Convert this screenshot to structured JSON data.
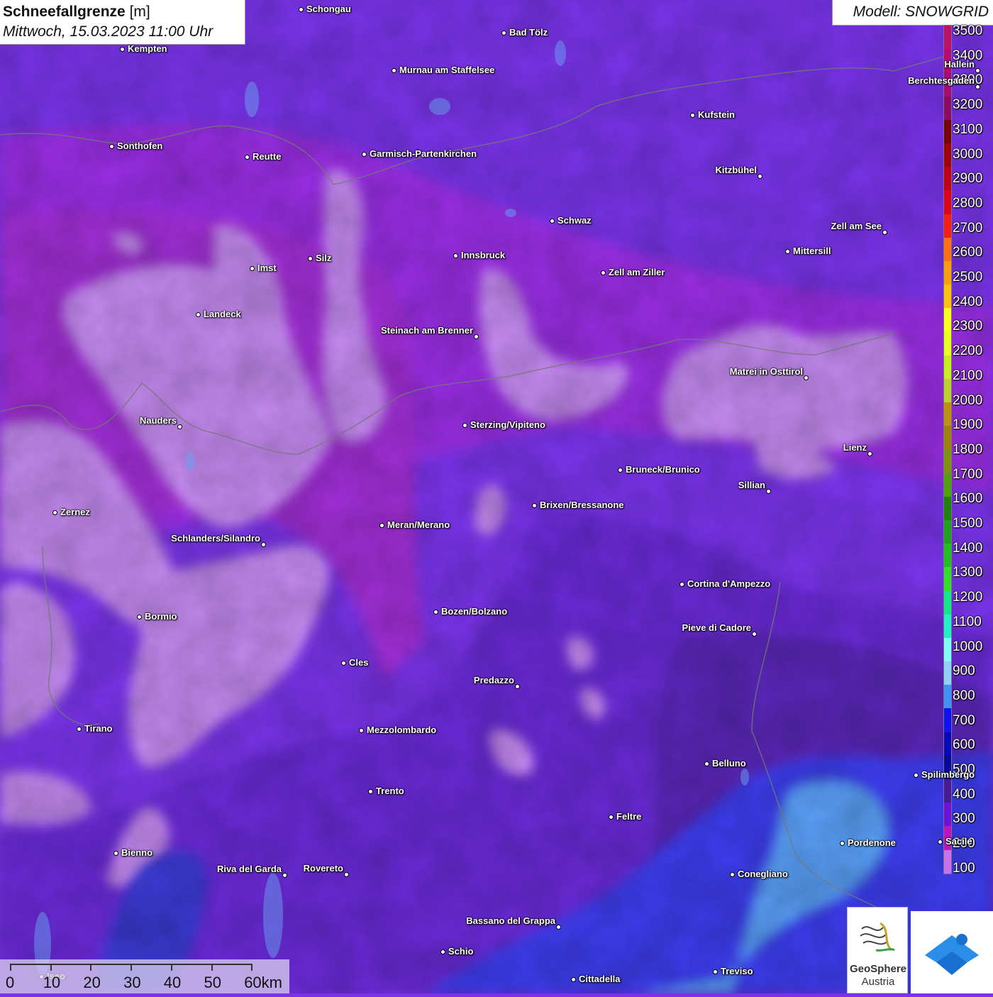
{
  "header": {
    "title_bold": "Schneefallgrenze",
    "title_unit": "[m]",
    "datetime": "Mittwoch, 15.03.2023 11:00 Uhr",
    "model": "Modell: SNOWGRID"
  },
  "legend": {
    "labels": [
      "3500",
      "3400",
      "3300",
      "3200",
      "3100",
      "3000",
      "2900",
      "2800",
      "2700",
      "2600",
      "2500",
      "2400",
      "2300",
      "2200",
      "2100",
      "2000",
      "1900",
      "1800",
      "1700",
      "1600",
      "1500",
      "1400",
      "1300",
      "1200",
      "1100",
      "1000",
      "900",
      "800",
      "700",
      "600",
      "500",
      "400",
      "300",
      "200",
      "100"
    ],
    "colors": [
      "#c0106e",
      "#b8087a",
      "#a8087a",
      "#90086a",
      "#7a0010",
      "#a00010",
      "#c00018",
      "#e00020",
      "#ff1a1a",
      "#ff7010",
      "#ff9c10",
      "#ffc010",
      "#ffff20",
      "#e8ff20",
      "#c8f020",
      "#c0d030",
      "#c09010",
      "#a08010",
      "#809010",
      "#50a010",
      "#208010",
      "#20a020",
      "#20c020",
      "#30e030",
      "#10e890",
      "#20f0d0",
      "#80ffff",
      "#90d0ff",
      "#4090ff",
      "#1010ff",
      "#0808c0",
      "#0808a0",
      "#4818a0",
      "#7010e0",
      "#c010c8",
      "#c870f0"
    ]
  },
  "places": [
    {
      "name": "Schongau"
    },
    {
      "name": "Bad Tölz"
    },
    {
      "name": "Kempten"
    },
    {
      "name": "Murnau am Staffelsee"
    },
    {
      "name": "Hallein"
    },
    {
      "name": "Berchtesgaden"
    },
    {
      "name": "Kufstein"
    },
    {
      "name": "Sonthofen"
    },
    {
      "name": "Reutte"
    },
    {
      "name": "Garmisch-Partenkirchen"
    },
    {
      "name": "Kitzbühel"
    },
    {
      "name": "Schwaz"
    },
    {
      "name": "Zell am See"
    },
    {
      "name": "Mittersill"
    },
    {
      "name": "Innsbruck"
    },
    {
      "name": "Imst"
    },
    {
      "name": "Silz"
    },
    {
      "name": "Zell am Ziller"
    },
    {
      "name": "Landeck"
    },
    {
      "name": "Steinach am Brenner"
    },
    {
      "name": "Matrei in Osttirol"
    },
    {
      "name": "Nauders"
    },
    {
      "name": "Sterzing/Vipiteno"
    },
    {
      "name": "Lienz"
    },
    {
      "name": "Bruneck/Brunico"
    },
    {
      "name": "Sillian"
    },
    {
      "name": "Brixen/Bressanone"
    },
    {
      "name": "Zernez"
    },
    {
      "name": "Meran/Merano"
    },
    {
      "name": "Schlanders/Silandro"
    },
    {
      "name": "Cortina d'Ampezzo"
    },
    {
      "name": "Bozen/Bolzano"
    },
    {
      "name": "Bormio"
    },
    {
      "name": "Pieve di Cadore"
    },
    {
      "name": "Cles"
    },
    {
      "name": "Predazzo"
    },
    {
      "name": "Tirano"
    },
    {
      "name": "Mezzolombardo"
    },
    {
      "name": "Belluno"
    },
    {
      "name": "Spilimbergo"
    },
    {
      "name": "Trento"
    },
    {
      "name": "Feltre"
    },
    {
      "name": "Pordenone"
    },
    {
      "name": "Bienno"
    },
    {
      "name": "Riva del Garda"
    },
    {
      "name": "Rovereto"
    },
    {
      "name": "Conegliano"
    },
    {
      "name": "Bassano del Grappa"
    },
    {
      "name": "Schio"
    },
    {
      "name": "Treviso"
    },
    {
      "name": "Cittadella"
    },
    {
      "name": "Sacile"
    },
    {
      "name": "Iseo"
    }
  ],
  "scalebar": {
    "labels": [
      "0",
      "10",
      "20",
      "30",
      "40",
      "50",
      "60km"
    ]
  },
  "logos": {
    "geosphere_line1": "GeoSphere",
    "geosphere_line2": "Austria"
  }
}
